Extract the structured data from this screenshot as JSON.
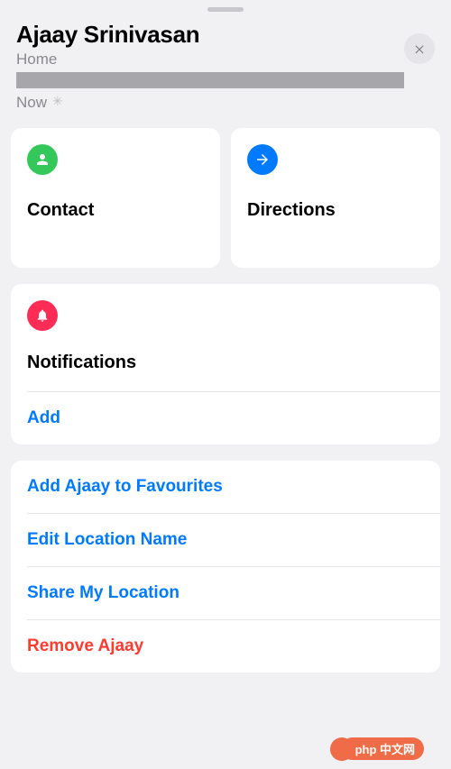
{
  "header": {
    "name": "Ajaay Srinivasan",
    "locationLabel": "Home",
    "statusText": "Now"
  },
  "tiles": {
    "contact": "Contact",
    "directions": "Directions"
  },
  "notifications": {
    "title": "Notifications",
    "add": "Add"
  },
  "actions": {
    "addFavourite": "Add Ajaay to Favourites",
    "editLocation": "Edit Location Name",
    "shareLocation": "Share My Location",
    "remove": "Remove Ajaay"
  },
  "watermark": "php 中文网"
}
